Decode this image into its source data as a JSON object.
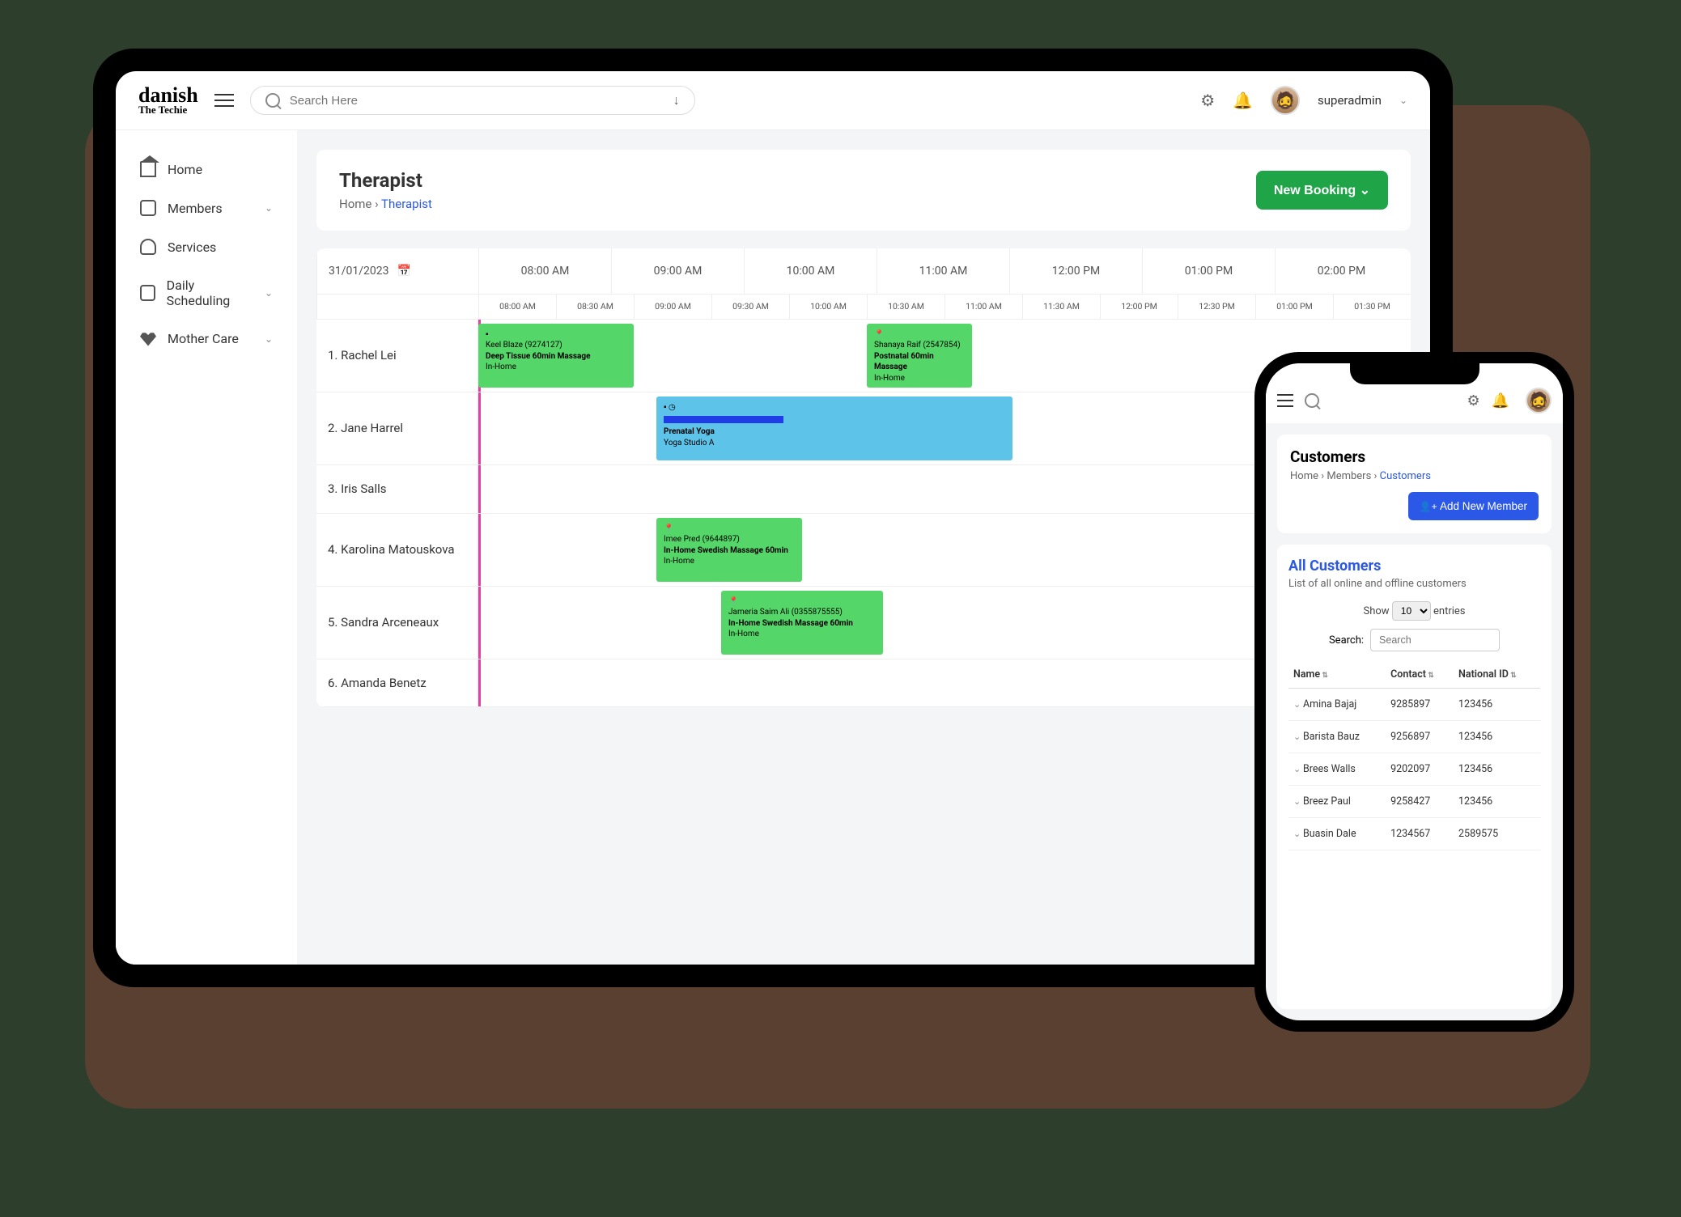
{
  "logo": {
    "line1": "danish",
    "line2": "The Techie"
  },
  "topbar": {
    "search_placeholder": "Search Here",
    "user": "superadmin"
  },
  "sidebar": {
    "items": [
      {
        "label": "Home",
        "expandable": false
      },
      {
        "label": "Members",
        "expandable": true
      },
      {
        "label": "Services",
        "expandable": false
      },
      {
        "label": "Daily Scheduling",
        "expandable": true
      },
      {
        "label": "Mother Care",
        "expandable": true
      }
    ]
  },
  "page": {
    "title": "Therapist",
    "crumb_home": "Home",
    "crumb_sep": " › ",
    "crumb_current": "Therapist",
    "new_booking": "New Booking ⌄"
  },
  "schedule": {
    "date": "31/01/2023",
    "major_times": [
      "08:00 AM",
      "09:00 AM",
      "10:00 AM",
      "11:00 AM",
      "12:00 PM",
      "01:00 PM",
      "02:00 PM"
    ],
    "minor_times": [
      "08:00 AM",
      "08:30 AM",
      "09:00 AM",
      "09:30 AM",
      "10:00 AM",
      "10:30 AM",
      "11:00 AM",
      "11:30 AM",
      "12:00 PM",
      "12:30 PM",
      "01:00 PM",
      "01:30 PM"
    ],
    "rows": [
      {
        "name": "1. Rachel Lei"
      },
      {
        "name": "2. Jane Harrel"
      },
      {
        "name": "3. Iris Salls"
      },
      {
        "name": "4. Karolina Matouskova"
      },
      {
        "name": "5. Sandra Arceneaux"
      },
      {
        "name": "6. Amanda Benetz"
      }
    ],
    "events": {
      "r1a": {
        "sub": "Keel Blaze (9274127)",
        "title": "Deep Tissue 60min Massage",
        "loc": "In-Home"
      },
      "r1b": {
        "sub": "Shanaya Raif (2547854)",
        "title": "Postnatal 60min Massage",
        "loc": "In-Home"
      },
      "r2": {
        "title": "Prenatal Yoga",
        "loc": "Yoga Studio A"
      },
      "r4": {
        "sub": "Imee Pred (9644897)",
        "title": "In-Home Swedish Massage 60min",
        "loc": "In-Home"
      },
      "r5": {
        "sub": "Jameria Saim Ali (0355875555)",
        "title": "In-Home Swedish Massage 60min",
        "loc": "In-Home"
      }
    }
  },
  "phone": {
    "title": "Customers",
    "crumb": {
      "home": "Home",
      "members": "Members",
      "current": "Customers",
      "sep": " › "
    },
    "add_button": "Add New Member",
    "card_title": "All Customers",
    "card_sub": "List of all online and offline customers",
    "show_label_pre": "Show",
    "show_value": "10",
    "show_label_post": "entries",
    "search_label": "Search:",
    "search_placeholder": "Search",
    "columns": {
      "name": "Name",
      "contact": "Contact",
      "nid": "National ID"
    },
    "rows": [
      {
        "name": "Amina Bajaj",
        "contact": "9285897",
        "nid": "123456"
      },
      {
        "name": "Barista Bauz",
        "contact": "9256897",
        "nid": "123456"
      },
      {
        "name": "Brees Walls",
        "contact": "9202097",
        "nid": "123456"
      },
      {
        "name": "Breez Paul",
        "contact": "9258427",
        "nid": "123456"
      },
      {
        "name": "Buasin Dale",
        "contact": "1234567",
        "nid": "2589575"
      }
    ]
  }
}
